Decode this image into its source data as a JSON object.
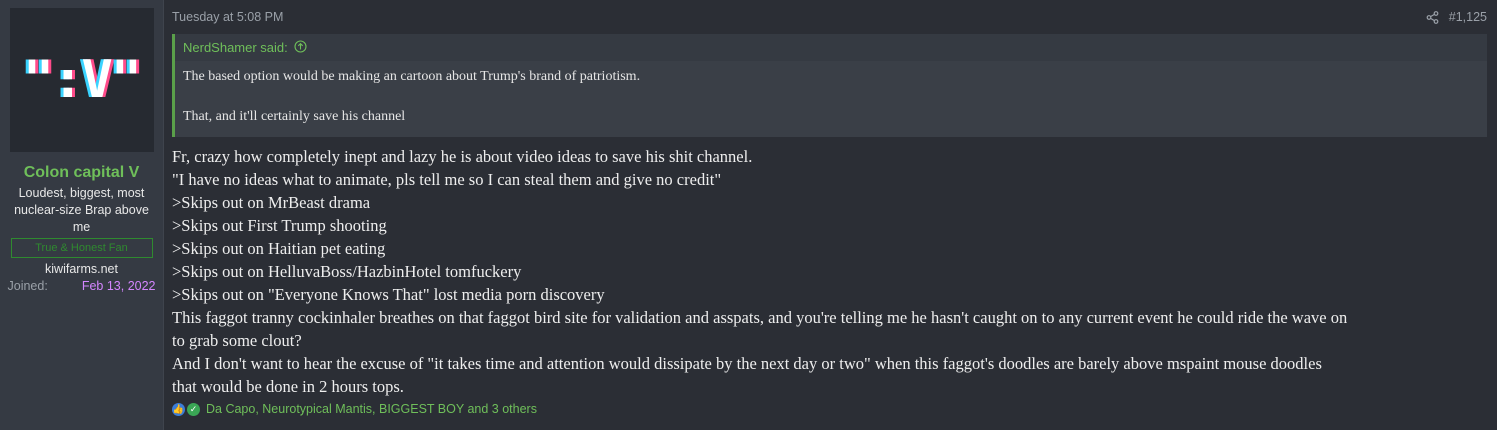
{
  "user": {
    "avatar_text": "\":V\"",
    "name": "Colon capital V",
    "title": "Loudest, biggest, most nuclear-size Brap above me",
    "banner": "True & Honest Fan",
    "site": "kiwifarms.net",
    "joined_label": "Joined:",
    "joined_value": "Feb 13, 2022"
  },
  "post": {
    "timestamp": "Tuesday at 5:08 PM",
    "number": "#1,125",
    "share_icon": "share-icon",
    "quote": {
      "author_label": "NerdShamer said:",
      "lines": [
        "The based option would be making an cartoon about Trump's brand of patriotism.",
        "That, and it'll certainly save his channel"
      ]
    },
    "body_lines": [
      "Fr, crazy how completely inept and lazy he is about video ideas to save his shit channel.",
      "\"I have no ideas what to animate, pls tell me so I can steal them and give no credit\"",
      ">Skips out on MrBeast drama",
      ">Skips out First Trump shooting",
      ">Skips out on Haitian pet eating",
      ">Skips out on HelluvaBoss/HazbinHotel tomfuckery",
      ">Skips out on \"Everyone Knows That\" lost media porn discovery",
      "This faggot tranny cockinhaler breathes on that faggot bird site for validation and asspats, and you're telling me he hasn't caught on to any current event he could ride the wave on",
      "to grab some clout?",
      "And I don't want to hear the excuse of \"it takes time and attention would dissipate by the next day or two\" when this faggot's doodles are barely above mspaint mouse doodles",
      "that would be done in 2 hours tops."
    ],
    "reactions": "Da Capo, Neurotypical Mantis, BIGGEST BOY and 3 others"
  },
  "colors": {
    "username": "#6fbf5a",
    "joined_date": "#d486ff",
    "quote_border": "#5aa04a",
    "background": "#2b2e35"
  }
}
